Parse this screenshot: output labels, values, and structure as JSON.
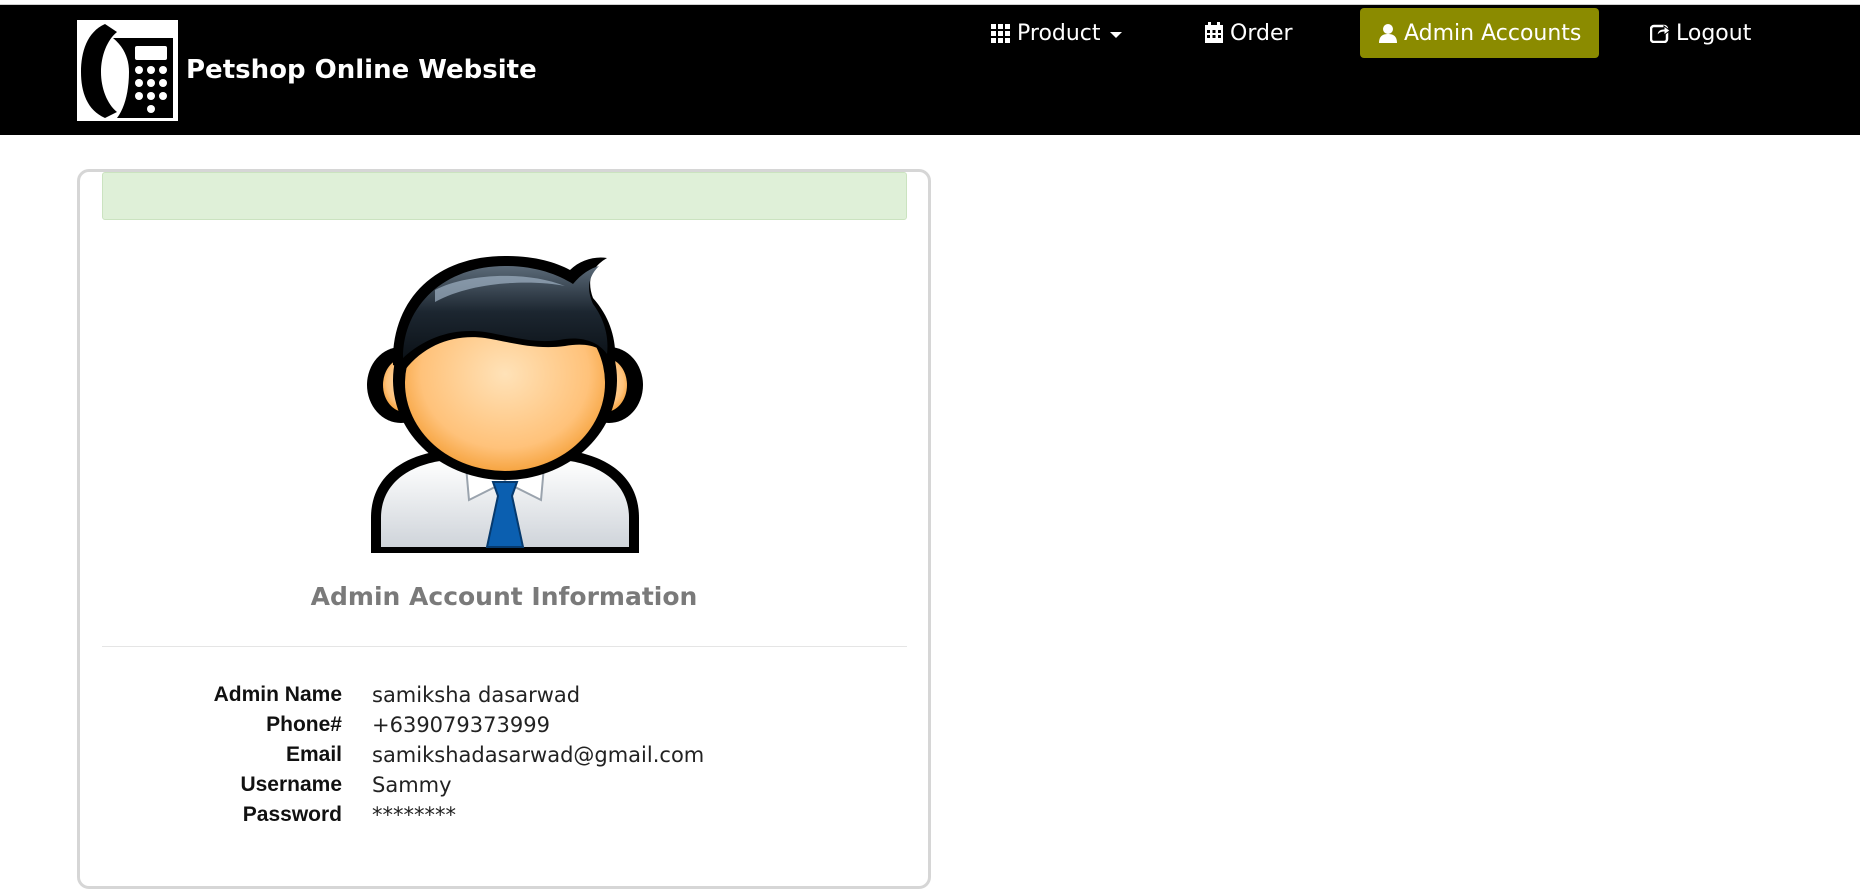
{
  "header": {
    "site_title": "Petshop Online Website",
    "logo_icon": "phone-calculator-icon",
    "background_color": "#000000"
  },
  "nav": {
    "items": [
      {
        "label": "Product",
        "icon": "grid-icon",
        "has_dropdown": true,
        "active": false
      },
      {
        "label": "Order",
        "icon": "calendar-icon",
        "has_dropdown": false,
        "active": false
      },
      {
        "label": "Admin Accounts",
        "icon": "user-icon",
        "has_dropdown": false,
        "active": true
      },
      {
        "label": "Logout",
        "icon": "share-icon",
        "has_dropdown": false,
        "active": false
      }
    ],
    "active_color": "#8b8b00"
  },
  "panel": {
    "alert_text": "",
    "alert_color": "#dff0d8",
    "avatar_icon": "admin-avatar-icon",
    "title": "Admin Account Information",
    "fields": [
      {
        "label": "Admin Name",
        "value": "samiksha dasarwad"
      },
      {
        "label": "Phone#",
        "value": "+639079373999"
      },
      {
        "label": "Email",
        "value": "samikshadasarwad@gmail.com"
      },
      {
        "label": "Username",
        "value": "Sammy"
      },
      {
        "label": "Password",
        "value": "********"
      }
    ]
  }
}
